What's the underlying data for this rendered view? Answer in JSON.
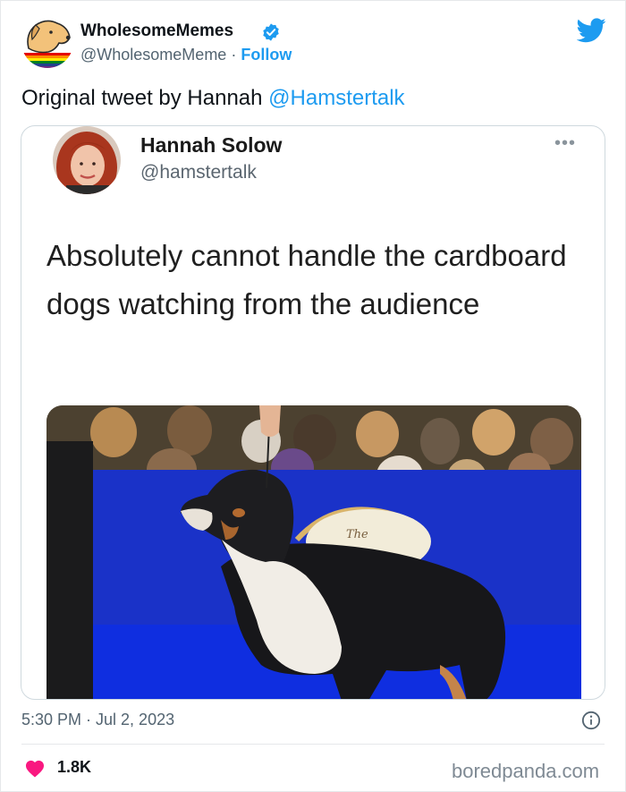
{
  "author": {
    "name": "WholesomeMemes",
    "handle": "@WholesomeMeme",
    "separator": " · ",
    "follow_label": "Follow"
  },
  "tweet": {
    "text_prefix": "Original tweet by Hannah ",
    "mention": "@Hamstertalk"
  },
  "embedded_tweet": {
    "name": "Hannah Solow",
    "handle": "@hamstertalk",
    "more_label": "•••",
    "text": "Absolutely cannot handle the cardboard dogs watching from the audience",
    "photo_sign_text": "The"
  },
  "footer": {
    "timestamp": "5:30 PM · Jul 2, 2023",
    "like_count": "1.8K",
    "watermark": "boredpanda.com"
  },
  "colors": {
    "accent": "#1d9bf0",
    "heart": "#f91880",
    "stage_blue": "#1a32c8"
  },
  "icons": {
    "verified": "verified-badge-icon",
    "twitter": "twitter-bird-icon",
    "info": "info-icon",
    "heart": "heart-icon"
  }
}
